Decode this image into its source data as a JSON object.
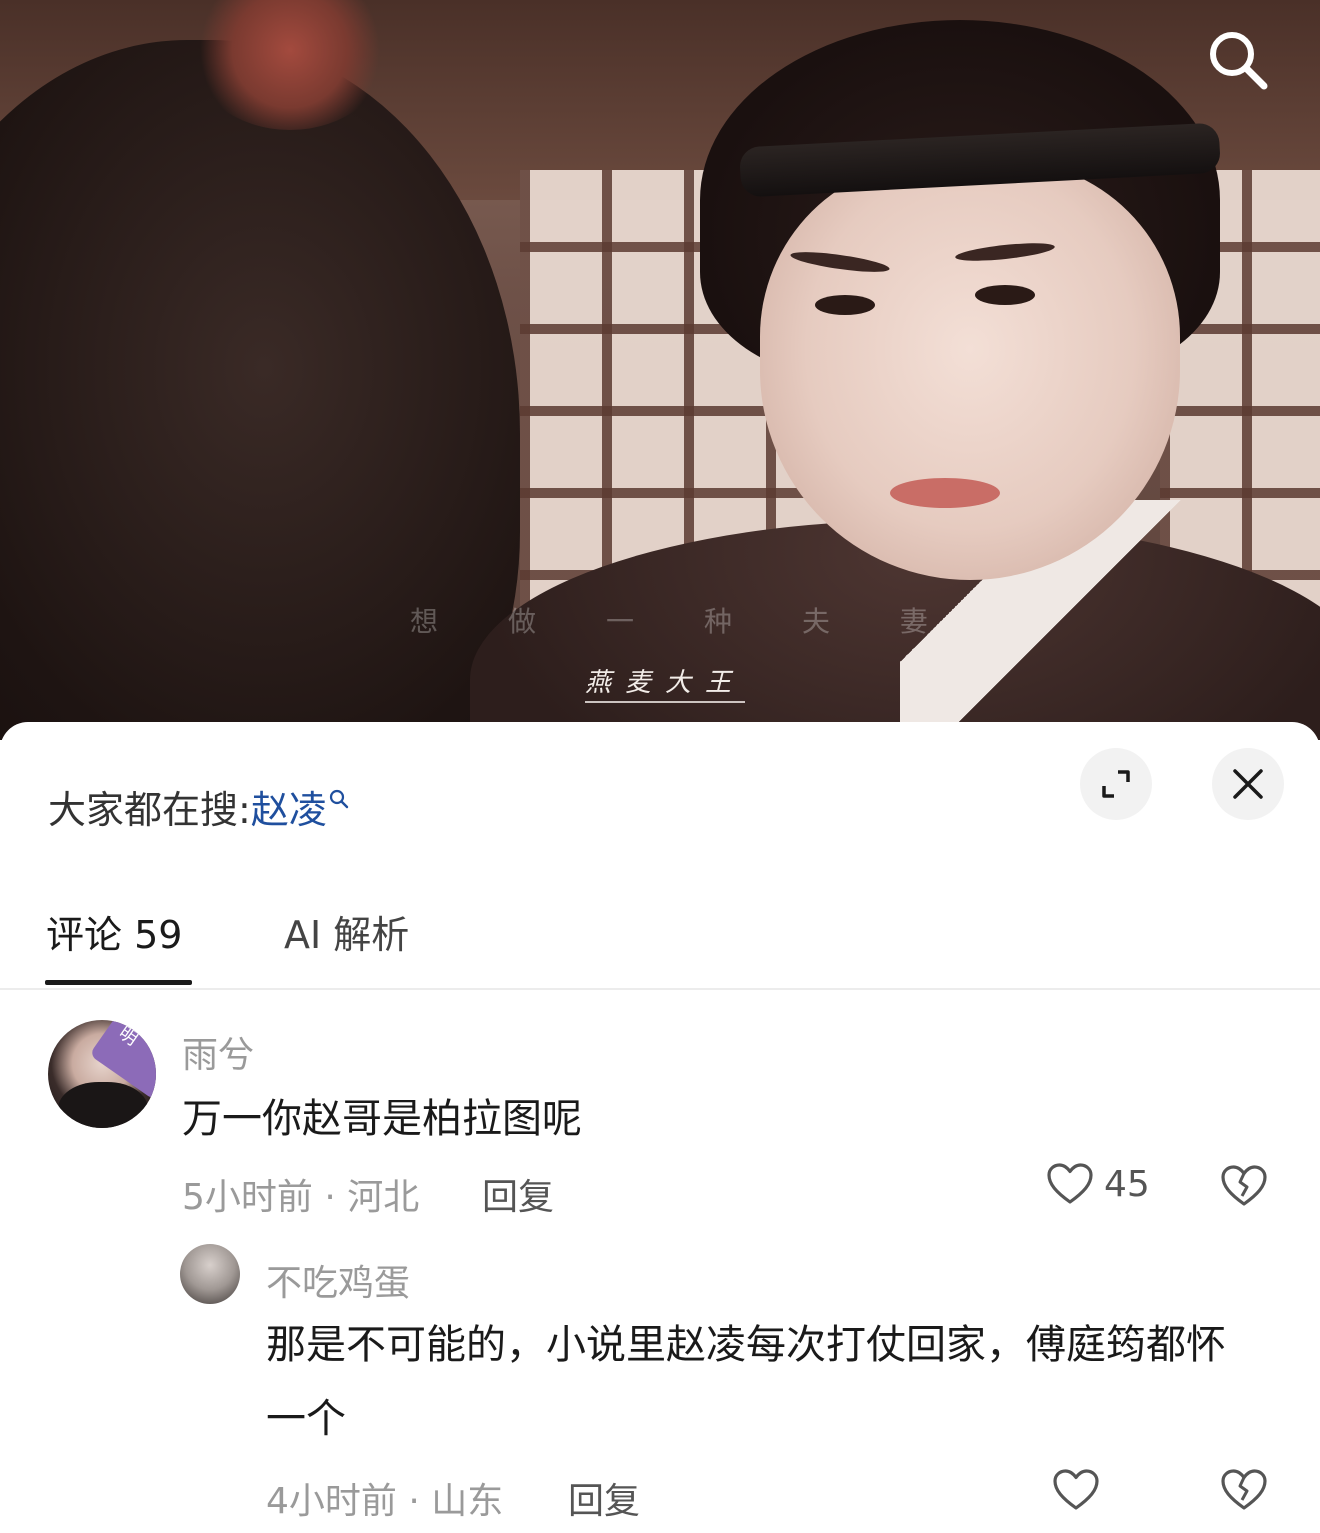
{
  "video": {
    "subtitle_faint_chars": [
      "想",
      "做",
      "一",
      "种",
      "夫",
      "妻"
    ],
    "watermark": "燕麦大王",
    "search_icon": "search-icon"
  },
  "hot_search": {
    "label": "大家都在搜:",
    "keyword": "赵凌"
  },
  "sheet_buttons": {
    "expand_icon": "expand-icon",
    "close_icon": "close-icon"
  },
  "tabs": [
    {
      "label": "评论 59",
      "active": true
    },
    {
      "label": "AI 解析",
      "active": false
    }
  ],
  "comments": [
    {
      "author": "雨兮",
      "avatar_badge": "明",
      "text": "万一你赵哥是柏拉图呢",
      "meta": "5小时前 · 河北",
      "reply_label": "回复",
      "likes": "45",
      "replies": [
        {
          "author": "不吃鸡蛋",
          "text": "那是不可能的，小说里赵凌每次打仗回家，傅庭筠都怀一个",
          "meta": "4小时前 · 山东",
          "reply_label": "回复"
        }
      ]
    }
  ],
  "colors": {
    "keyword": "#1f4f9e",
    "text_primary": "#1a1a1a",
    "text_muted": "#9a9a9a"
  }
}
